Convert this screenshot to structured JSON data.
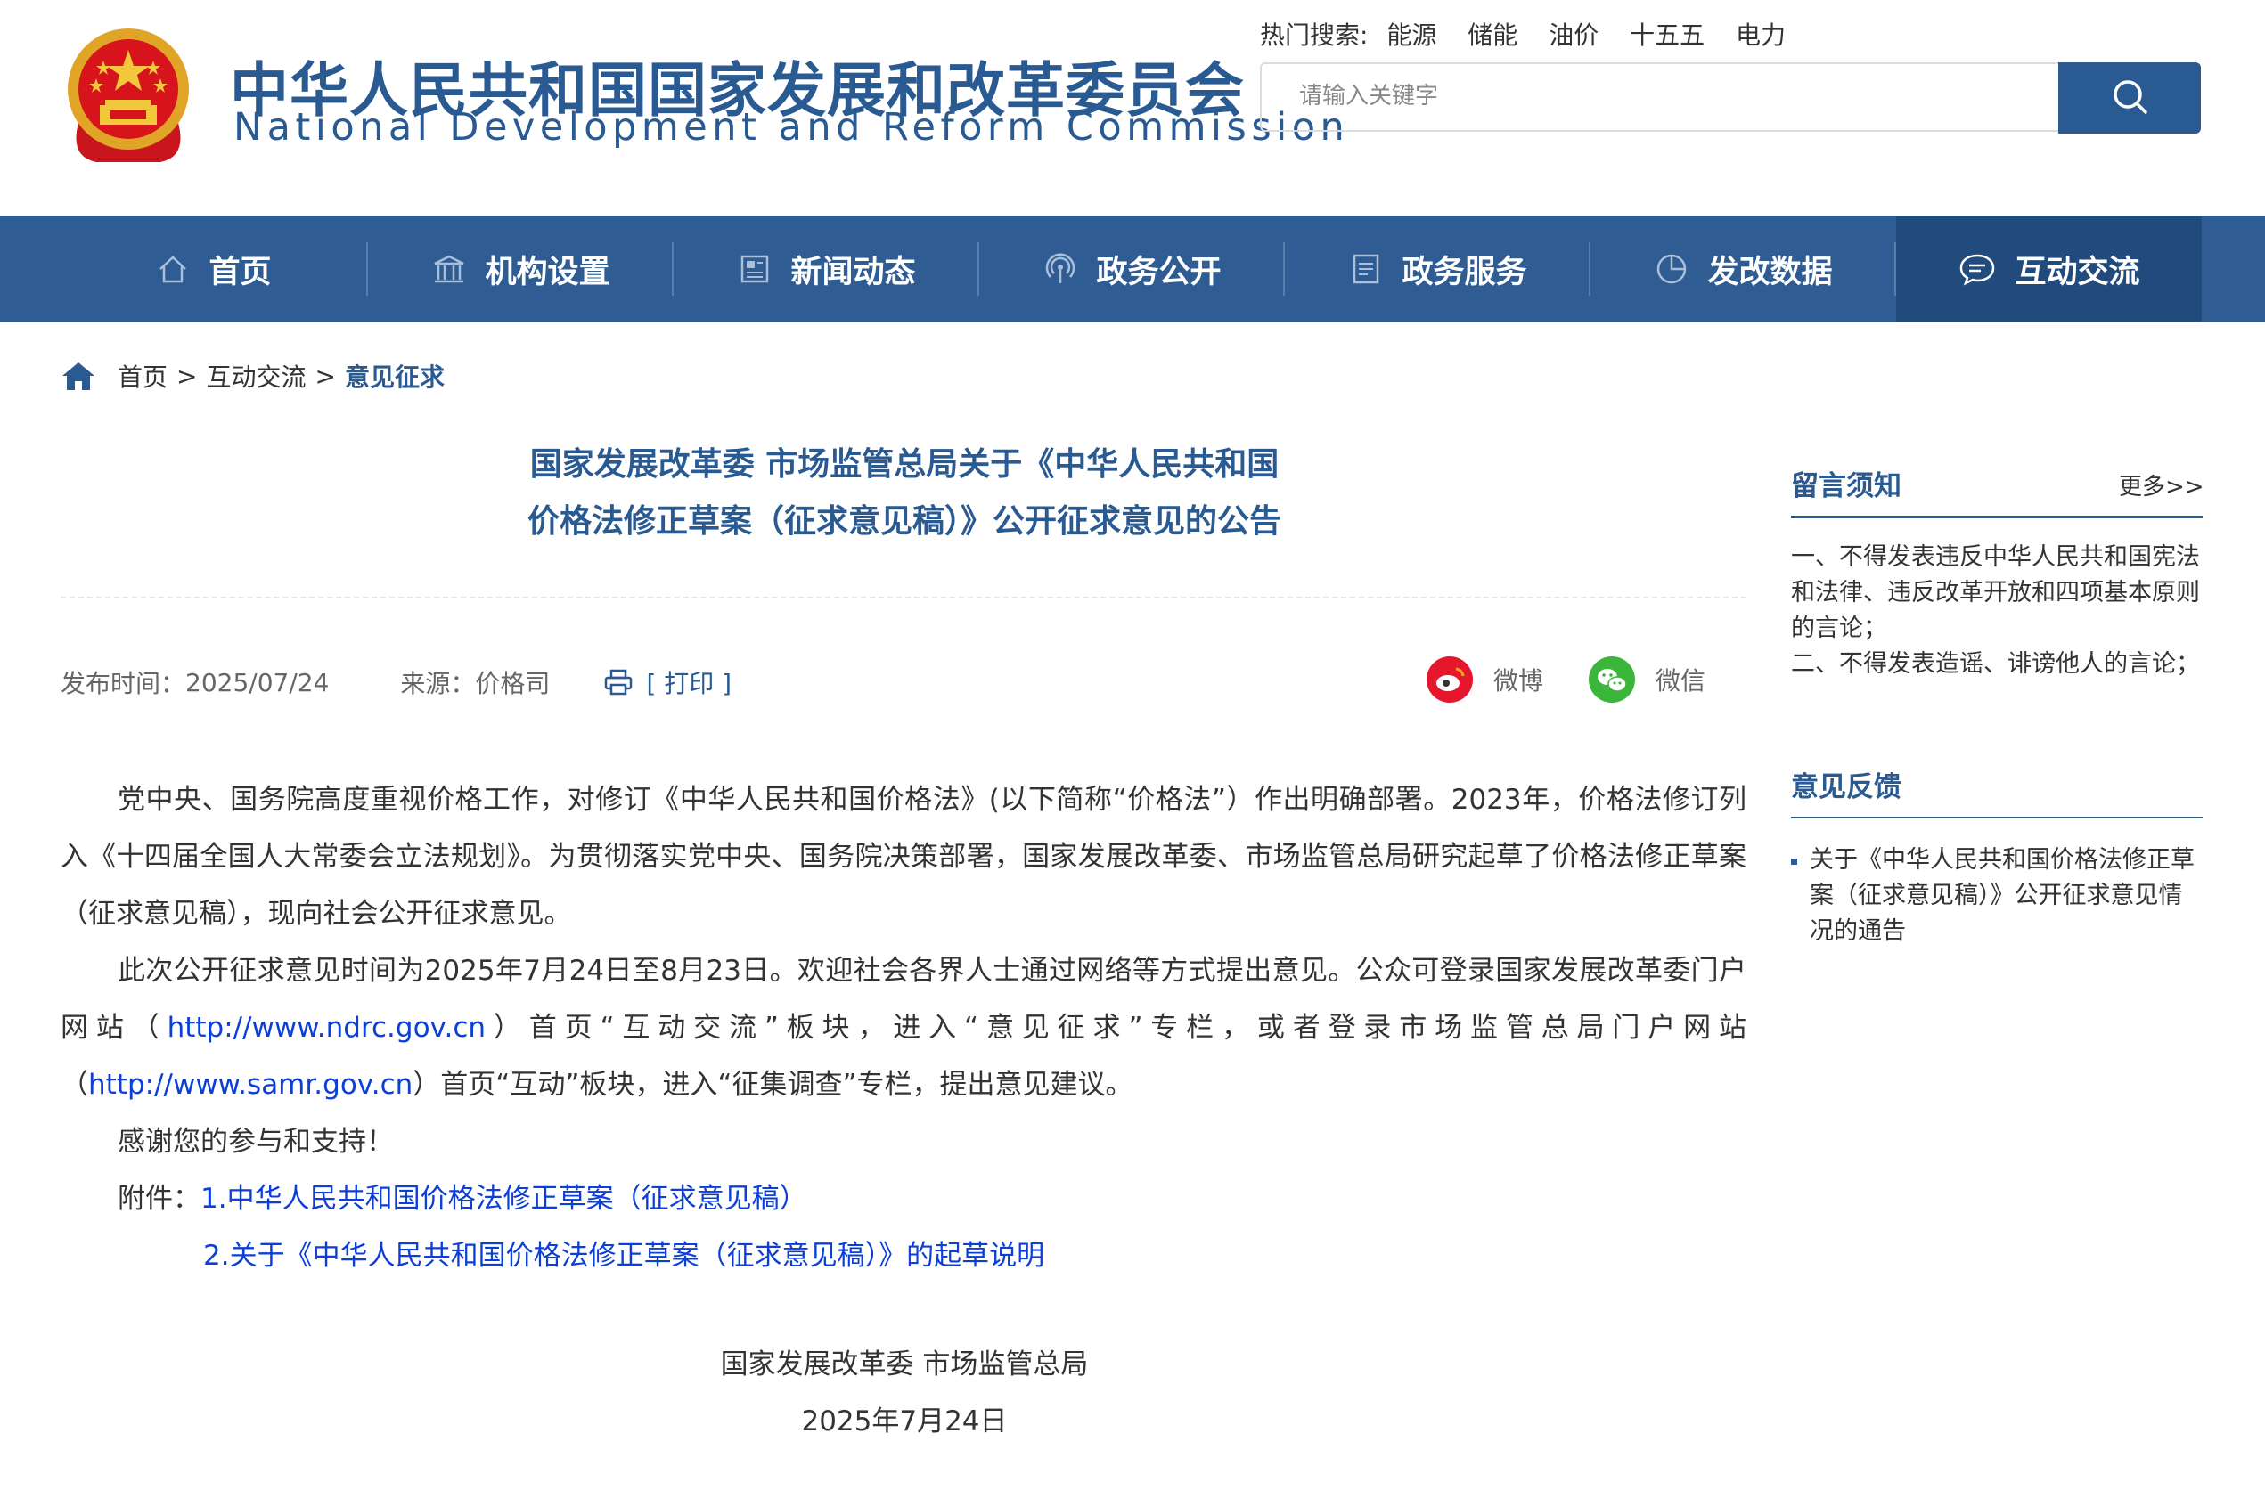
{
  "header": {
    "title_cn": "中华人民共和国国家发展和改革委员会",
    "title_en": "National Development and Reform Commission",
    "hot_label": "热门搜索:",
    "hot_keywords": [
      "能源",
      "储能",
      "油价",
      "十五五",
      "电力"
    ],
    "search_placeholder": "请输入关键字",
    "emblem_icon": "national-emblem-icon",
    "search_icon": "search-icon"
  },
  "nav": [
    {
      "label": "首页",
      "icon": "home-icon"
    },
    {
      "label": "机构设置",
      "icon": "building-icon"
    },
    {
      "label": "新闻动态",
      "icon": "news-icon"
    },
    {
      "label": "政务公开",
      "icon": "broadcast-icon"
    },
    {
      "label": "政务服务",
      "icon": "document-icon"
    },
    {
      "label": "发改数据",
      "icon": "pie-chart-icon"
    },
    {
      "label": "互动交流",
      "icon": "chat-icon",
      "active": true
    }
  ],
  "breadcrumb": {
    "home": "首页",
    "sep": ">",
    "level1": "互动交流",
    "current": "意见征求"
  },
  "article": {
    "title_line1": "国家发展改革委 市场监管总局关于《中华人民共和国",
    "title_line2": "价格法修正草案（征求意见稿）》公开征求意见的公告",
    "publish_label": "发布时间：",
    "publish_date": "2025/07/24",
    "source_label": "来源：",
    "source": "价格司",
    "print_label": "[ 打印 ]",
    "share_weibo": "微博",
    "share_wechat": "微信",
    "para1": "党中央、国务院高度重视价格工作，对修订《中华人民共和国价格法》(以下简称“价格法”）作出明确部署。2023年，价格法修订列入《十四届全国人大常委会立法规划》。为贯彻落实党中央、国务院决策部署，国家发展改革委、市场监管总局研究起草了价格法修正草案（征求意见稿），现向社会公开征求意见。",
    "para2_a": "此次公开征求意见时间为2025年7月24日至8月23日。欢迎社会各界人士通过网络等方式提出意见。公众可登录国家发展改革委门户网站（",
    "link1": "http://www.ndrc.gov.cn",
    "para2_b": "）首页“互动交流”板块，进入“意见征求”专栏，或者登录市场监管总局门户网站（",
    "link2": "http://www.samr.gov.cn",
    "para2_c": "）首页“互动”板块，进入“征集调查”专栏，提出意见建议。",
    "para3": "感谢您的参与和支持！",
    "attach_label": "附件：",
    "attach1": "1.中华人民共和国价格法修正草案（征求意见稿）",
    "attach2": "2.关于《中华人民共和国价格法修正草案（征求意见稿）》的起草说明",
    "sign_org": "国家发展改革委 市场监管总局",
    "sign_date": "2025年7月24日"
  },
  "sidebar": {
    "notice_title": "留言须知",
    "more": "更多>>",
    "notice_1": "一、不得发表违反中华人民共和国宪法和法律、违反改革开放和四项基本原则的言论；",
    "notice_2": "二、不得发表造谣、诽谤他人的言论；",
    "feedback_title": "意见反馈",
    "feedback_item": "关于《中华人民共和国价格法修正草案（征求意见稿）》公开征求意见情况的通告"
  },
  "colors": {
    "brand": "#2a5a92",
    "nav_bg": "#2f5d93",
    "nav_active": "#224b7d",
    "link": "#0b3fd8"
  }
}
